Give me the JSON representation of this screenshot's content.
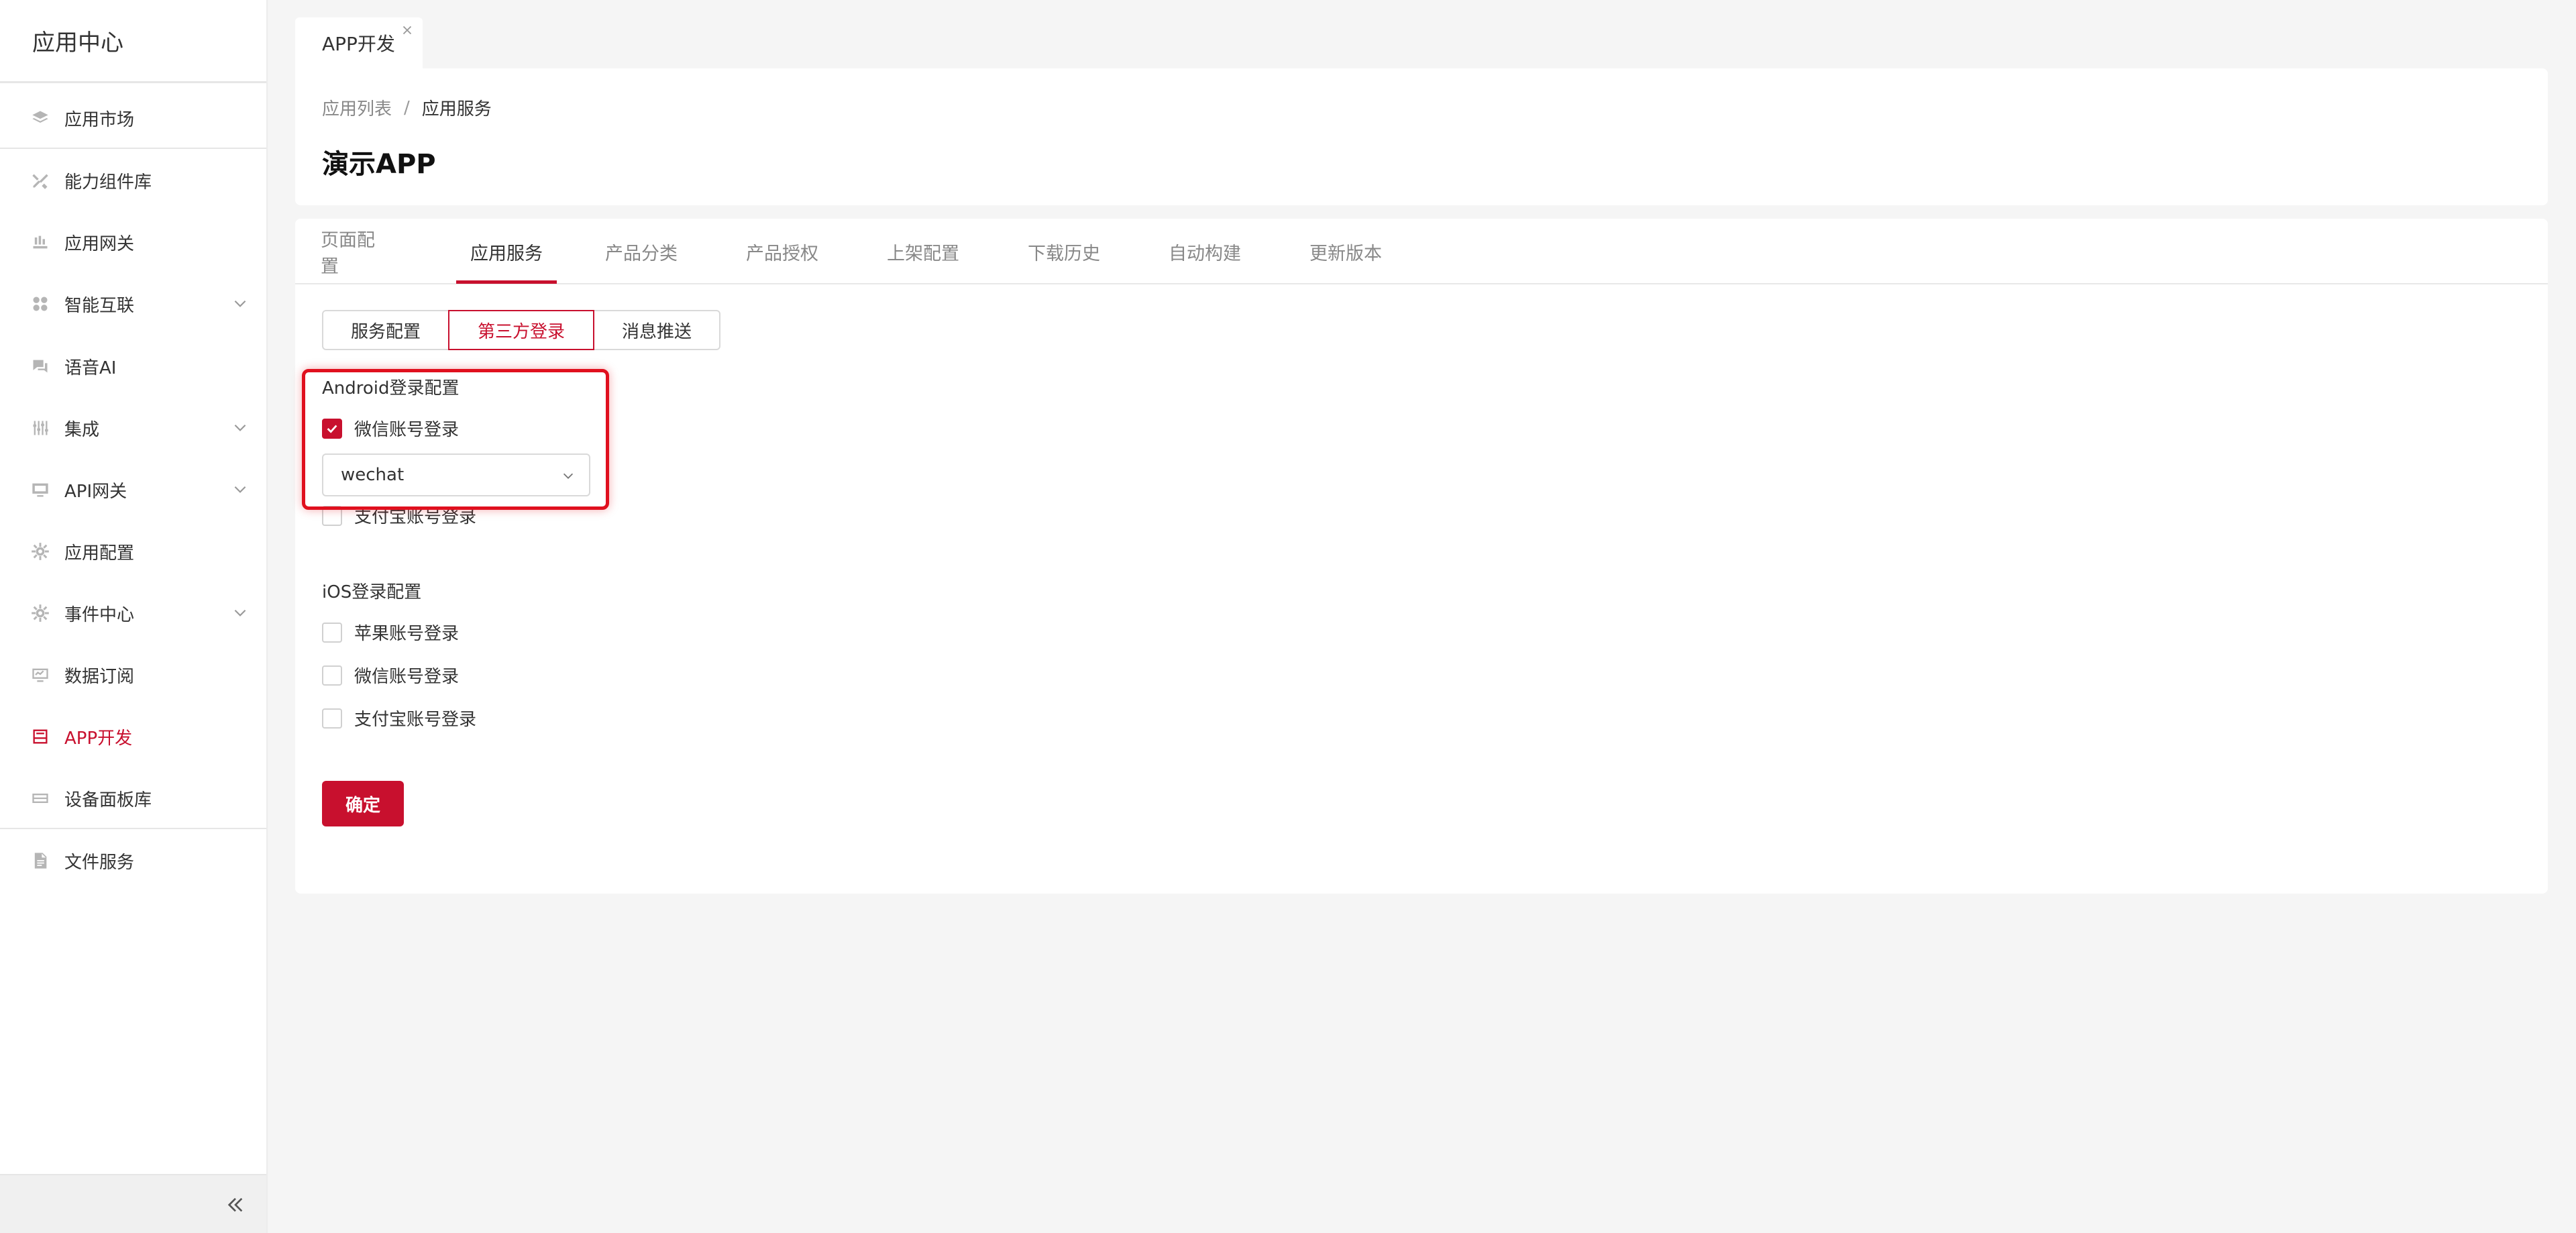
{
  "sidebar": {
    "title": "应用中心",
    "items": [
      {
        "label": "应用市场",
        "icon": "layers-icon"
      },
      {
        "label": "能力组件库",
        "icon": "tools-icon"
      },
      {
        "label": "应用网关",
        "icon": "gateway-icon"
      },
      {
        "label": "智能互联",
        "icon": "grid-icon",
        "expandable": true
      },
      {
        "label": "语音AI",
        "icon": "chat-icon"
      },
      {
        "label": "集成",
        "icon": "sliders-icon",
        "expandable": true
      },
      {
        "label": "API网关",
        "icon": "monitor-icon",
        "expandable": true
      },
      {
        "label": "应用配置",
        "icon": "gear-icon"
      },
      {
        "label": "事件中心",
        "icon": "gear-icon",
        "expandable": true
      },
      {
        "label": "数据订阅",
        "icon": "screen-icon"
      },
      {
        "label": "APP开发",
        "icon": "app-icon",
        "active": true
      },
      {
        "label": "设备面板库",
        "icon": "panel-icon"
      },
      {
        "label": "文件服务",
        "icon": "file-icon"
      }
    ]
  },
  "page_tab": {
    "label": "APP开发"
  },
  "breadcrumb": {
    "parent": "应用列表",
    "separator": "/",
    "current": "应用服务"
  },
  "page_title": "演示APP",
  "tabs": [
    "页面配置",
    "应用服务",
    "产品分类",
    "产品授权",
    "上架配置",
    "下载历史",
    "自动构建",
    "更新版本"
  ],
  "active_tab": "应用服务",
  "segments": [
    "服务配置",
    "第三方登录",
    "消息推送"
  ],
  "active_segment": "第三方登录",
  "android": {
    "label": "Android登录配置",
    "wechat_label": "微信账号登录",
    "wechat_checked": true,
    "wechat_select_value": "wechat",
    "alipay_label": "支付宝账号登录",
    "alipay_checked": false
  },
  "ios": {
    "label": "iOS登录配置",
    "options": [
      {
        "label": "苹果账号登录",
        "checked": false
      },
      {
        "label": "微信账号登录",
        "checked": false
      },
      {
        "label": "支付宝账号登录",
        "checked": false
      }
    ]
  },
  "confirm_label": "确定",
  "colors": {
    "accent": "#c8102e",
    "highlight": "#e0101e",
    "bg": "#f5f5f5"
  }
}
